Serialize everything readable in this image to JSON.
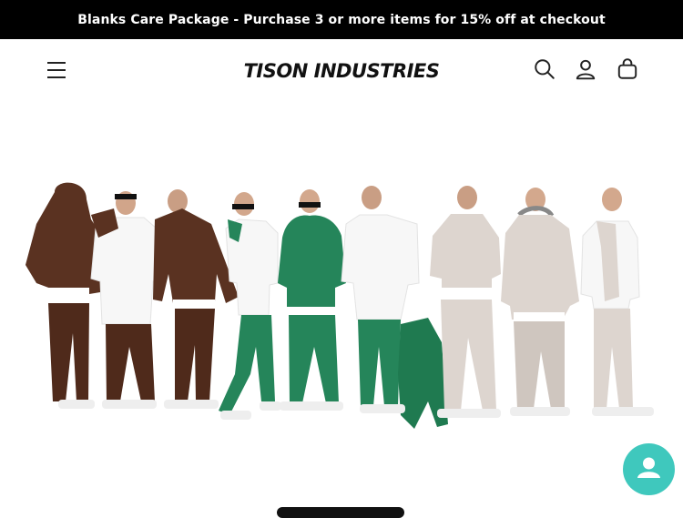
{
  "announcement": {
    "text": "Blanks Care Package - Purchase 3 or more items for 15% off at checkout"
  },
  "header": {
    "logo_text_primary": "TISON",
    "logo_text_secondary": "INDUSTRIES",
    "icons": [
      "menu-icon",
      "search-icon",
      "account-icon",
      "cart-icon"
    ]
  },
  "hero": {
    "models": [
      {
        "outfit": "brown hoodie, brown pants"
      },
      {
        "outfit": "white tee, brown pants"
      },
      {
        "outfit": "brown hoodie, brown pants"
      },
      {
        "outfit": "white tee, green pants"
      },
      {
        "outfit": "green hoodie, green pants"
      },
      {
        "outfit": "white tee, green pants"
      },
      {
        "outfit": "cream hoodie, cream pants"
      },
      {
        "outfit": "cream hoodie, cream pants"
      },
      {
        "outfit": "white tee, cream pants"
      }
    ]
  },
  "colors": {
    "announce_bg": "#000000",
    "chat_bg": "#3fc8bd",
    "brown": "#5a3221",
    "green": "#25855a",
    "cream": "#ddd5cf"
  }
}
